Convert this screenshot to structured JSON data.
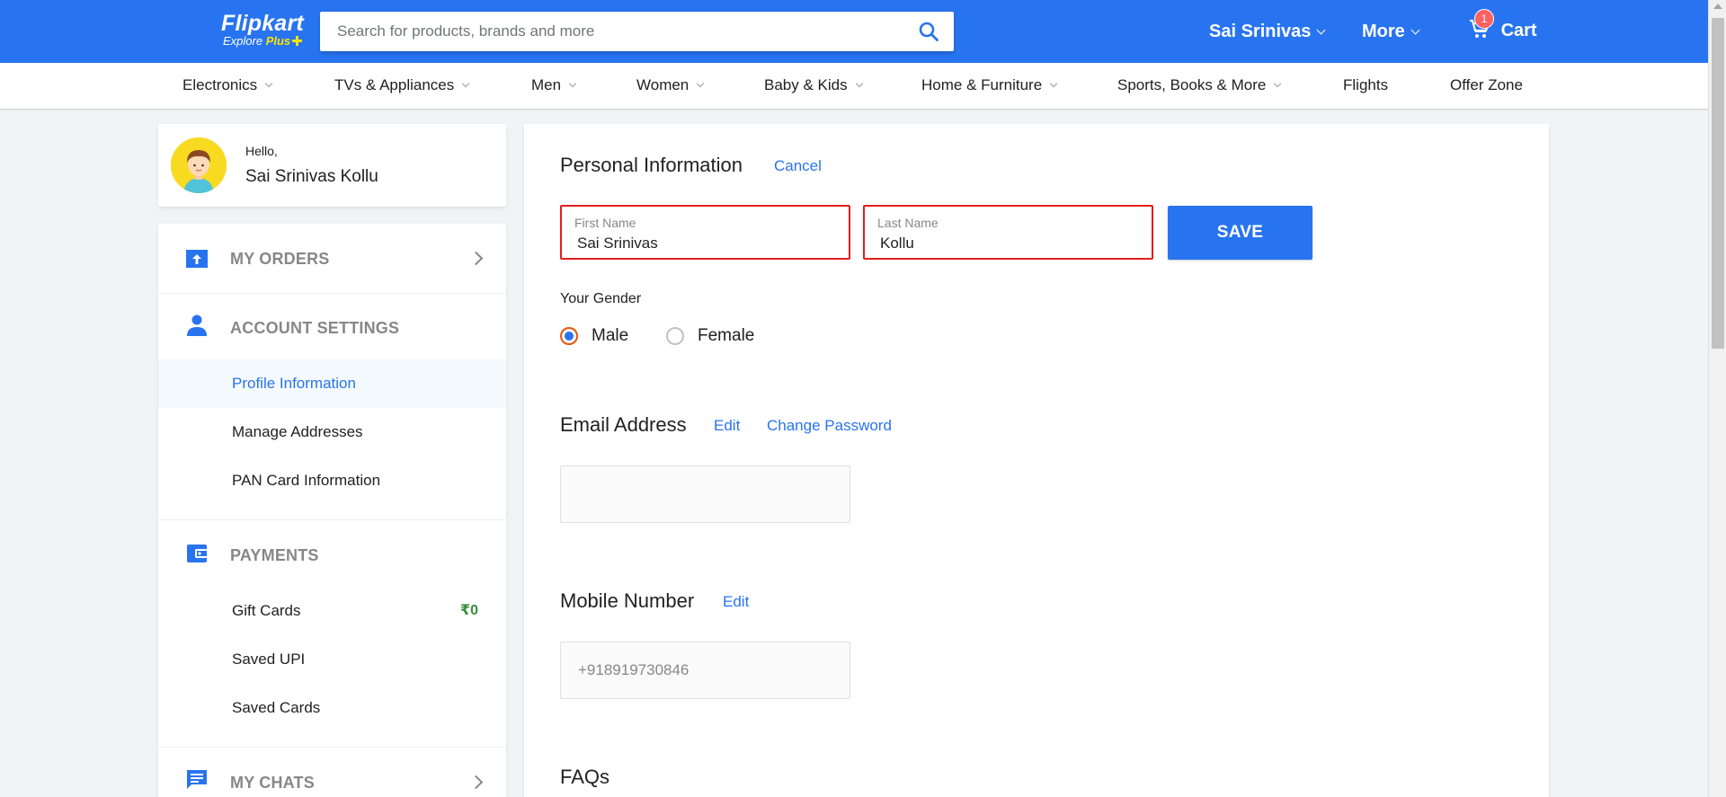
{
  "header": {
    "logo": {
      "brand": "Flipkart",
      "tagline_prefix": "Explore",
      "tagline_plus": "Plus"
    },
    "search": {
      "placeholder": "Search for products, brands and more",
      "value": ""
    },
    "user_menu": "Sai Srinivas",
    "more_menu": "More",
    "cart": {
      "label": "Cart",
      "count": "1"
    }
  },
  "categories": [
    {
      "label": "Electronics",
      "has_dropdown": true
    },
    {
      "label": "TVs & Appliances",
      "has_dropdown": true
    },
    {
      "label": "Men",
      "has_dropdown": true
    },
    {
      "label": "Women",
      "has_dropdown": true
    },
    {
      "label": "Baby & Kids",
      "has_dropdown": true
    },
    {
      "label": "Home & Furniture",
      "has_dropdown": true
    },
    {
      "label": "Sports, Books & More",
      "has_dropdown": true
    },
    {
      "label": "Flights",
      "has_dropdown": false
    },
    {
      "label": "Offer Zone",
      "has_dropdown": false
    }
  ],
  "profile_card": {
    "greeting": "Hello,",
    "name": "Sai Srinivas Kollu"
  },
  "sidebar": {
    "my_orders": "MY ORDERS",
    "account_settings": {
      "title": "ACCOUNT SETTINGS",
      "items": [
        "Profile Information",
        "Manage Addresses",
        "PAN Card Information"
      ]
    },
    "payments": {
      "title": "PAYMENTS",
      "gift_cards": {
        "label": "Gift Cards",
        "value": "₹0"
      },
      "saved_upi": "Saved UPI",
      "saved_cards": "Saved Cards"
    },
    "my_chats": "MY CHATS"
  },
  "personal_info": {
    "title": "Personal Information",
    "cancel": "Cancel",
    "first_name": {
      "label": "First Name",
      "value": "Sai Srinivas"
    },
    "last_name": {
      "label": "Last Name",
      "value": "Kollu"
    },
    "save": "SAVE",
    "gender_label": "Your Gender",
    "gender_options": [
      "Male",
      "Female"
    ],
    "gender_selected": "Male"
  },
  "email": {
    "title": "Email Address",
    "edit": "Edit",
    "change_password": "Change Password",
    "value": ""
  },
  "mobile": {
    "title": "Mobile Number",
    "edit": "Edit",
    "value": "+918919730846"
  },
  "faqs": {
    "title": "FAQs"
  },
  "colors": {
    "primary": "#2874f0",
    "error_border": "#e01e1e",
    "badge": "#ff6161",
    "wallet_value": "#388e3c"
  }
}
